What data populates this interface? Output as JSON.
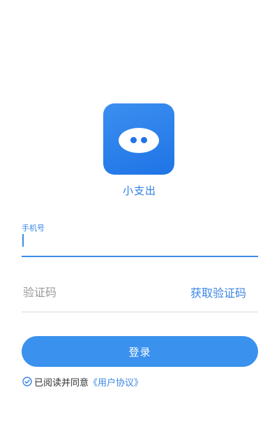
{
  "app": {
    "name": "小支出",
    "accent_color": "#3a91ee"
  },
  "logo": {
    "icon": "app-logo-face-icon",
    "background_color": "#1f74e6"
  },
  "form": {
    "phone": {
      "label": "手机号",
      "value": "",
      "placeholder": ""
    },
    "code": {
      "placeholder": "验证码",
      "value": "",
      "get_code_label": "获取验证码"
    },
    "login_label": "登录"
  },
  "agreement": {
    "checked": true,
    "check_icon": "checkmark-circle-icon",
    "prefix": "已阅读并同意",
    "link_label": "《用户协议》"
  }
}
